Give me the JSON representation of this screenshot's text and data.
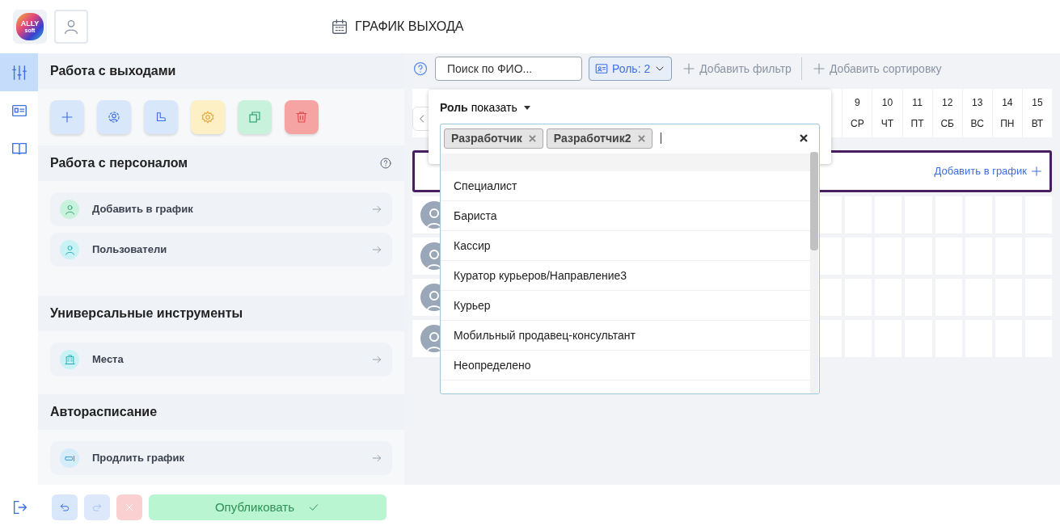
{
  "header": {
    "logo": "ALLY",
    "logo_sub": "soft",
    "title": "ГРАФИК ВЫХОДА"
  },
  "rail": [
    {
      "kind": "sliders",
      "selected": true
    },
    {
      "kind": "card",
      "selected": false
    },
    {
      "kind": "book",
      "selected": false
    }
  ],
  "sections": [
    {
      "title": "Работа с выходами",
      "tools": [
        {
          "kind": "add"
        },
        {
          "kind": "person-scan"
        },
        {
          "kind": "boot"
        },
        {
          "kind": "gear"
        },
        {
          "kind": "copy"
        },
        {
          "kind": "delete"
        }
      ]
    },
    {
      "title": "Работа с персоналом",
      "help": true,
      "items": [
        {
          "label": "Добавить в график",
          "kind": "person-green"
        },
        {
          "label": "Пользователи",
          "kind": "person-cyan"
        }
      ]
    },
    {
      "title": "Универсальные инструменты",
      "items": [
        {
          "label": "Места",
          "kind": "building"
        }
      ]
    },
    {
      "title": "Авторасписание",
      "items": [
        {
          "label": "Продлить график",
          "kind": "extend"
        }
      ]
    }
  ],
  "footer": {
    "actions": [
      {
        "kind": "undo",
        "disabled": false
      },
      {
        "kind": "redo",
        "disabled": true
      },
      {
        "kind": "cancel",
        "disabled": true
      }
    ],
    "publish": {
      "label": "Опубликовать",
      "disabled": true
    }
  },
  "toolbar": {
    "search": {
      "placeholder": "Поиск по ФИО..."
    },
    "role_filter": "Роль: 2",
    "add_filter": "Добавить фильтр",
    "add_sort": "Добавить сортировку"
  },
  "schedule": {
    "days": [
      {
        "day": "9",
        "weekday": "СР"
      },
      {
        "day": "10",
        "weekday": "ЧТ"
      },
      {
        "day": "11",
        "weekday": "ПТ"
      },
      {
        "day": "12",
        "weekday": "СБ"
      },
      {
        "day": "13",
        "weekday": "ВС"
      },
      {
        "day": "14",
        "weekday": "ПН"
      },
      {
        "day": "15",
        "weekday": "ВТ"
      }
    ],
    "group_action": "Добавить в график",
    "rows": [
      {
        "kind": "employee"
      },
      {
        "kind": "employee"
      },
      {
        "kind": "employee"
      },
      {
        "kind": "employee"
      }
    ]
  },
  "popup": {
    "field": "Роль",
    "mode": "показать",
    "tags": [
      "Разработчик",
      "Разработчик2"
    ],
    "options": [
      "Специалист",
      "Бариста",
      "Кассир",
      "Куратор курьеров/Направление3",
      "Курьер",
      "Мобильный продавец-консультант",
      "Неопределено"
    ]
  }
}
